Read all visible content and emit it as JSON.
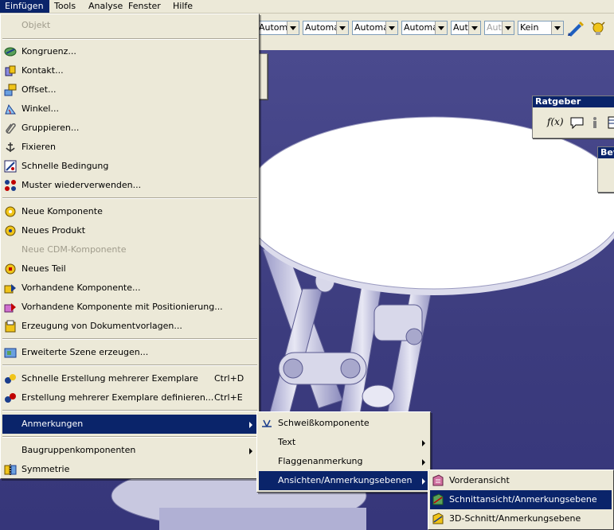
{
  "menubar": {
    "items": [
      {
        "label": "Einfügen",
        "active": true
      },
      {
        "label": "Tools"
      },
      {
        "label": "Analyse"
      },
      {
        "label": "Fenster"
      },
      {
        "label": "Hilfe"
      }
    ]
  },
  "toolbar": {
    "combos": [
      {
        "value": "Automa"
      },
      {
        "value": "Automa"
      },
      {
        "value": "Automa"
      },
      {
        "value": "Automa"
      },
      {
        "value": "Aut"
      },
      {
        "value": "Aut",
        "disabled": true
      },
      {
        "value": "Kein"
      }
    ]
  },
  "panels": {
    "ratgeber_title": "Ratgeber",
    "bew_title": "Bev"
  },
  "main_menu": {
    "items": [
      {
        "label": "Objekt",
        "disabled": true,
        "icon": "none"
      },
      {
        "label": "Kongruenz...",
        "icon": "coincidence-icon"
      },
      {
        "label": "Kontakt...",
        "icon": "contact-icon"
      },
      {
        "label": "Offset...",
        "icon": "offset-icon"
      },
      {
        "label": "Winkel...",
        "icon": "angle-icon"
      },
      {
        "label": "Gruppieren...",
        "icon": "paperclip-icon"
      },
      {
        "label": "Fixieren",
        "icon": "anchor-icon"
      },
      {
        "label": "Schnelle Bedingung",
        "icon": "quick-constraint-icon"
      },
      {
        "label": "Muster wiederverwenden...",
        "icon": "pattern-icon"
      },
      {
        "label": "Neue Komponente",
        "icon": "gear-icon"
      },
      {
        "label": "Neues Produkt",
        "icon": "gear-icon"
      },
      {
        "label": "Neue CDM-Komponente",
        "disabled": true,
        "icon": "none"
      },
      {
        "label": "Neues Teil",
        "icon": "gear-icon"
      },
      {
        "label": "Vorhandene Komponente...",
        "icon": "existing-component-icon"
      },
      {
        "label": "Vorhandene Komponente mit Positionierung...",
        "icon": "positioning-icon"
      },
      {
        "label": "Erzeugung von Dokumentvorlagen...",
        "icon": "document-template-icon"
      },
      {
        "label": "Erweiterte Szene erzeugen...",
        "icon": "scene-icon"
      },
      {
        "label": "Schnelle Erstellung mehrerer Exemplare",
        "shortcut": "Ctrl+D",
        "icon": "multi-instance-icon"
      },
      {
        "label": "Erstellung mehrerer Exemplare definieren...",
        "shortcut": "Ctrl+E",
        "icon": "multi-instance-icon"
      },
      {
        "label": "Anmerkungen",
        "submenu": true,
        "selected": true,
        "icon": "none"
      },
      {
        "label": "Baugruppenkomponenten",
        "submenu": true,
        "icon": "none"
      },
      {
        "label": "Symmetrie",
        "icon": "symmetry-icon"
      }
    ]
  },
  "submenu_annotations": {
    "items": [
      {
        "label": "Schweißkomponente",
        "icon": "weld-icon"
      },
      {
        "label": "Text",
        "submenu": true
      },
      {
        "label": "Flaggenanmerkung",
        "submenu": true
      },
      {
        "label": "Ansichten/Anmerkungsebenen",
        "submenu": true,
        "selected": true
      }
    ]
  },
  "submenu_views": {
    "items": [
      {
        "label": "Vorderansicht",
        "icon": "front-view-icon"
      },
      {
        "label": "Schnittansicht/Anmerkungsebene",
        "selected": true,
        "icon": "section-view-icon"
      },
      {
        "label": "3D-Schnitt/Anmerkungsebene",
        "icon": "section-3d-icon"
      }
    ]
  }
}
